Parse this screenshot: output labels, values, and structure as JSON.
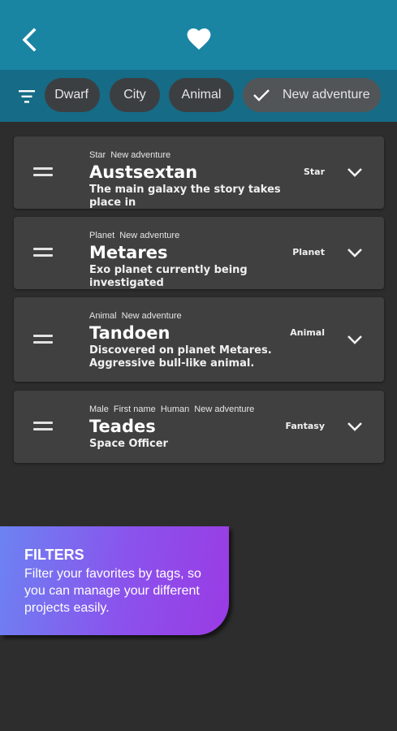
{
  "header": {
    "back_icon": "arrow-back-icon",
    "favorite_icon": "heart-icon"
  },
  "filters": {
    "filter_icon": "filter-list-icon",
    "chips": [
      {
        "label": "Dwarf",
        "selected": false
      },
      {
        "label": "City",
        "selected": false
      },
      {
        "label": "Animal",
        "selected": false
      },
      {
        "label": "New adventure",
        "selected": true
      }
    ]
  },
  "cards": [
    {
      "tags": [
        "Star",
        "New adventure"
      ],
      "title": "Austsextan",
      "description": "The main galaxy the story takes place in",
      "category": "Star"
    },
    {
      "tags": [
        "Planet",
        "New adventure"
      ],
      "title": "Metares",
      "description": "Exo planet currently being investigated",
      "category": "Planet"
    },
    {
      "tags": [
        "Animal",
        "New adventure"
      ],
      "title": "Tandoen",
      "description": "Discovered on planet Metares. Aggressive bull-like animal.",
      "category": "Animal"
    },
    {
      "tags": [
        "Male",
        "First name",
        "Human",
        "New adventure"
      ],
      "title": "Teades",
      "description": "Space Officer",
      "category": "Fantasy"
    }
  ],
  "tooltip": {
    "title": "FILTERS",
    "body": "Filter your favorites by tags, so you can manage your different projects easily."
  },
  "colors": {
    "header_bg": "#1a84a3",
    "filterbar_bg": "#166b86",
    "background": "#2d2d2d",
    "card_bg": "#404040",
    "tooltip_gradient_start": "#6c83f2",
    "tooltip_gradient_end": "#9a3be5"
  }
}
